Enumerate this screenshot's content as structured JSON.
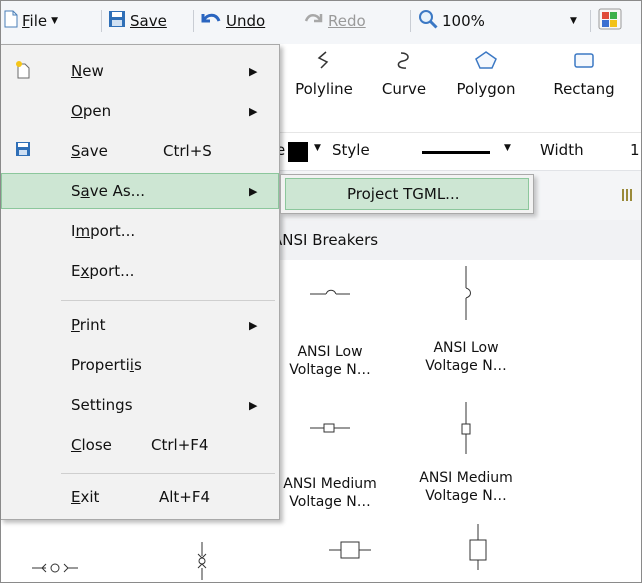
{
  "toolbar": {
    "file_label": "File",
    "save_label": "Save",
    "undo_label": "Undo",
    "redo_label": "Redo",
    "zoom_value": "100%"
  },
  "tools": {
    "polyline": "Polyline",
    "curve": "Curve",
    "polygon": "Polygon",
    "rectangle": "Rectang"
  },
  "style_row": {
    "fill_prefix": "e",
    "style_label": "Style",
    "width_label": "Width",
    "width_value": "1"
  },
  "palette": {
    "group_header": "ANSI Breakers",
    "items": [
      "ANSI Low\nVoltage N…",
      "ANSI Low\nVoltage N…",
      "ANSI Medium\nVoltage N…",
      "ANSI Medium\nVoltage N…"
    ]
  },
  "file_menu": {
    "new": "New",
    "open": "Open",
    "save": "Save",
    "save_shortcut": "Ctrl+S",
    "save_as": "Save As...",
    "import": "Import...",
    "export": "Export...",
    "print": "Print",
    "properties": "Properties",
    "settings": "Settings",
    "close": "Close",
    "close_shortcut": "Ctrl+F4",
    "exit": "Exit",
    "exit_shortcut": "Alt+F4"
  },
  "save_as_submenu": {
    "project_tgml": "Project TGML..."
  },
  "colors": {
    "menu_highlight": "#cde6d3",
    "menu_highlight_border": "#8cc79c",
    "menu_background": "#f2f2f2",
    "toolbar_background": "#f4f6f9"
  }
}
